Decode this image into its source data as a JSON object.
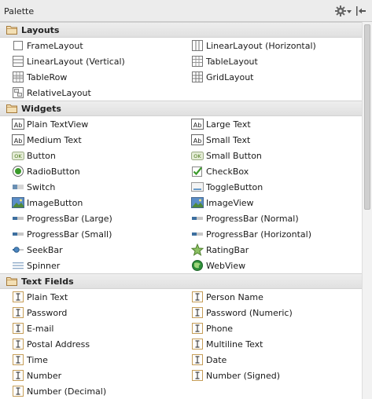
{
  "panel": {
    "title": "Palette"
  },
  "toolbar": {
    "settings_icon": "gear-icon",
    "hide_icon": "hide-panel-icon"
  },
  "categories": [
    {
      "name": "Layouts",
      "items": [
        {
          "label": "FrameLayout",
          "icon": "frame-layout"
        },
        {
          "label": "LinearLayout (Horizontal)",
          "icon": "linear-layout-horizontal"
        },
        {
          "label": "LinearLayout (Vertical)",
          "icon": "linear-layout-vertical"
        },
        {
          "label": "TableLayout",
          "icon": "table-layout"
        },
        {
          "label": "TableRow",
          "icon": "table-row"
        },
        {
          "label": "GridLayout",
          "icon": "grid-layout"
        },
        {
          "label": "RelativeLayout",
          "icon": "relative-layout"
        }
      ]
    },
    {
      "name": "Widgets",
      "items": [
        {
          "label": "Plain TextView",
          "icon": "textview"
        },
        {
          "label": "Large Text",
          "icon": "textview"
        },
        {
          "label": "Medium Text",
          "icon": "textview"
        },
        {
          "label": "Small Text",
          "icon": "textview"
        },
        {
          "label": "Button",
          "icon": "button"
        },
        {
          "label": "Small Button",
          "icon": "button"
        },
        {
          "label": "RadioButton",
          "icon": "radio"
        },
        {
          "label": "CheckBox",
          "icon": "checkbox"
        },
        {
          "label": "Switch",
          "icon": "switch"
        },
        {
          "label": "ToggleButton",
          "icon": "toggle"
        },
        {
          "label": "ImageButton",
          "icon": "image"
        },
        {
          "label": "ImageView",
          "icon": "image"
        },
        {
          "label": "ProgressBar (Large)",
          "icon": "progress"
        },
        {
          "label": "ProgressBar (Normal)",
          "icon": "progress"
        },
        {
          "label": "ProgressBar (Small)",
          "icon": "progress"
        },
        {
          "label": "ProgressBar (Horizontal)",
          "icon": "progress"
        },
        {
          "label": "SeekBar",
          "icon": "seekbar"
        },
        {
          "label": "RatingBar",
          "icon": "rating"
        },
        {
          "label": "Spinner",
          "icon": "spinner"
        },
        {
          "label": "WebView",
          "icon": "webview"
        }
      ]
    },
    {
      "name": "Text Fields",
      "items": [
        {
          "label": "Plain Text",
          "icon": "textfield"
        },
        {
          "label": "Person Name",
          "icon": "textfield"
        },
        {
          "label": "Password",
          "icon": "textfield"
        },
        {
          "label": "Password (Numeric)",
          "icon": "textfield"
        },
        {
          "label": "E-mail",
          "icon": "textfield"
        },
        {
          "label": "Phone",
          "icon": "textfield"
        },
        {
          "label": "Postal Address",
          "icon": "textfield"
        },
        {
          "label": "Multiline Text",
          "icon": "textfield"
        },
        {
          "label": "Time",
          "icon": "textfield"
        },
        {
          "label": "Date",
          "icon": "textfield"
        },
        {
          "label": "Number",
          "icon": "textfield"
        },
        {
          "label": "Number (Signed)",
          "icon": "textfield"
        },
        {
          "label": "Number (Decimal)",
          "icon": "textfield"
        }
      ]
    }
  ],
  "colors": {
    "category_bg": "#e6e6e6",
    "folder": "#c9a063",
    "accent_green": "#3a9a2a"
  }
}
